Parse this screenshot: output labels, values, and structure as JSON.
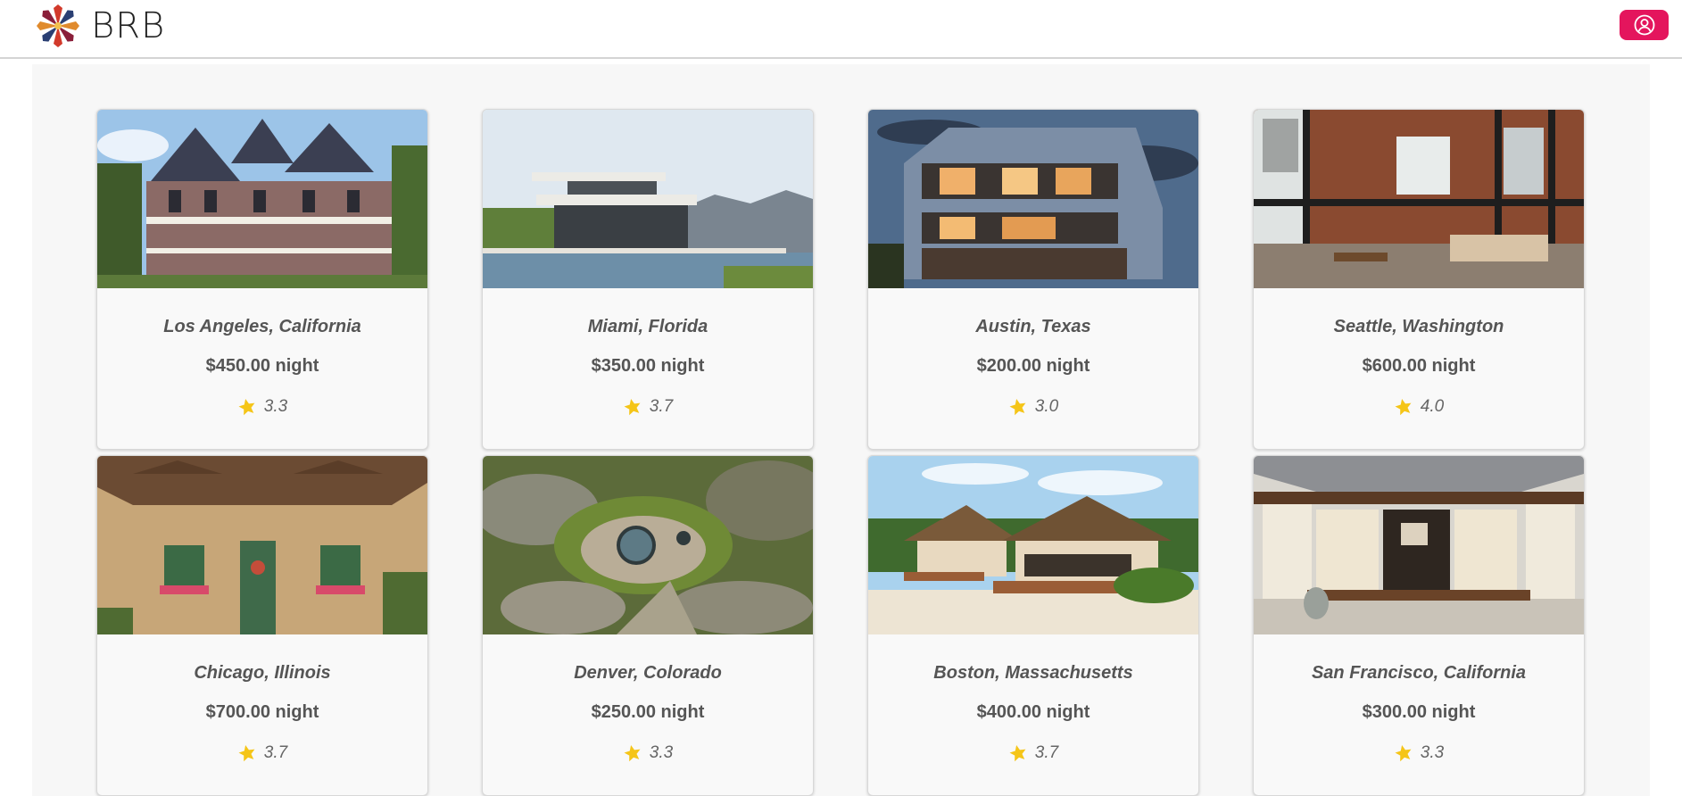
{
  "app": {
    "brand": "BRB",
    "accent": "#e4155d"
  },
  "listings": [
    {
      "location": "Los Angeles, California",
      "price": "$450.00 night",
      "rating": "3.3",
      "scene": "victorian"
    },
    {
      "location": "Miami, Florida",
      "price": "$350.00 night",
      "rating": "3.7",
      "scene": "modern-pool"
    },
    {
      "location": "Austin, Texas",
      "price": "$200.00 night",
      "rating": "3.0",
      "scene": "modern-dusk"
    },
    {
      "location": "Seattle, Washington",
      "price": "$600.00 night",
      "rating": "4.0",
      "scene": "loft"
    },
    {
      "location": "Chicago, Illinois",
      "price": "$700.00 night",
      "rating": "3.7",
      "scene": "cottage"
    },
    {
      "location": "Denver, Colorado",
      "price": "$250.00 night",
      "rating": "3.3",
      "scene": "earth-house"
    },
    {
      "location": "Boston, Massachusetts",
      "price": "$400.00 night",
      "rating": "3.7",
      "scene": "beach-bungalow"
    },
    {
      "location": "San Francisco, California",
      "price": "$300.00 night",
      "rating": "3.3",
      "scene": "japanese"
    }
  ]
}
